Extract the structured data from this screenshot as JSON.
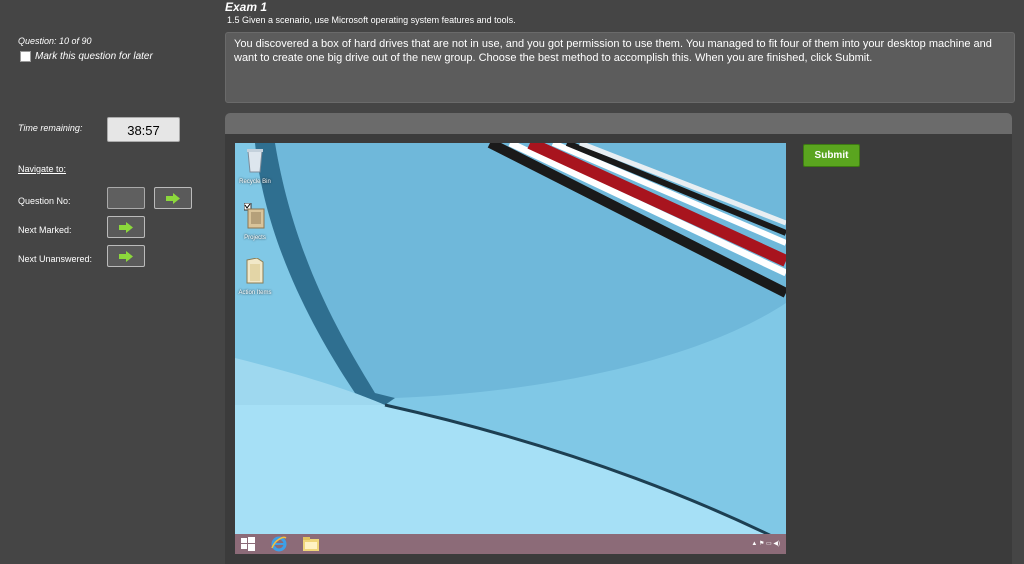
{
  "exam": {
    "title": "Exam 1",
    "objective": "1.5 Given a scenario, use Microsoft operating system features and tools."
  },
  "question": {
    "counter": "Question: 10 of 90",
    "mark_label": "Mark this question for later",
    "text": "You discovered a box of hard drives that are not in use, and you got permission to use them. You managed to fit four of them into your desktop machine and want to create one big drive out of the new group. Choose the best method to accomplish this. When you are finished, click Submit."
  },
  "timer": {
    "label": "Time remaining:",
    "value": "38:57"
  },
  "navigation": {
    "title": "Navigate to:",
    "question_no_label": "Question No:",
    "next_marked_label": "Next Marked:",
    "next_unanswered_label": "Next Unanswered:"
  },
  "simulation": {
    "submit_label": "Submit",
    "desktop_icons": [
      {
        "label": "Recycle Bin",
        "icon": "recycle-bin-icon"
      },
      {
        "label": "Projects",
        "icon": "projects-folder-icon"
      },
      {
        "label": "Action Items",
        "icon": "action-items-folder-icon"
      }
    ],
    "taskbar": {
      "tray_text": "▲ ⚑ ▭ ◀)"
    }
  },
  "colors": {
    "background": "#454545",
    "submit": "#5aa51f",
    "arrow": "#8cd83c",
    "taskbar": "#8c6b78"
  }
}
